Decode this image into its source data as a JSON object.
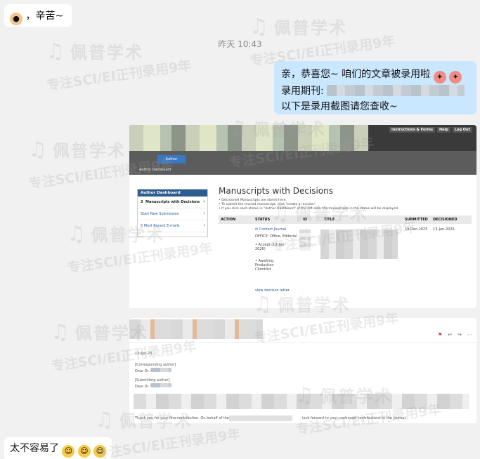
{
  "messages": {
    "first": {
      "text": "，辛苦~"
    },
    "timestamp": "昨天 10:43",
    "reply": {
      "line1": "亲，恭喜您~ 咱们的文章被录用啦",
      "line2_label": "录用期刊:",
      "line3": "以下是录用截图请您查收~"
    },
    "last": {
      "text": "太不容易了"
    }
  },
  "watermark": {
    "brand": "佩普学术",
    "slogan": "专注SCI/EI正刊录用9年"
  },
  "screenshot1": {
    "top_links": [
      "Instructions & Forms",
      "Help",
      "Log Out"
    ],
    "nav_tab": "Author",
    "dashboard_label": "Author Dashboard",
    "sidebar_title": "Author Dashboard",
    "sidebar_items": [
      {
        "count": "3",
        "label": "Manuscripts with Decisions"
      },
      {
        "label": "Start New Submission"
      },
      {
        "label": "5 Most Recent E-mails"
      }
    ],
    "main_title": "Manuscripts with Decisions",
    "bullets": [
      "Decisioned Manuscripts are stored here.",
      "To submit the revised manuscript, click \"create a revision\".",
      "If you click each status in \"Author Dashboard\" of the left side, the manuscripts in the status will be displayed."
    ],
    "columns": [
      "ACTION",
      "STATUS",
      "ID",
      "TITLE",
      "SUBMITTED",
      "DECISIONED"
    ],
    "row": {
      "contact": "Contact Journal",
      "office": "OFFICE: Office, Editorial",
      "accept": "Accept (13-Jan-2026)",
      "awaiting": "Awaiting Production Checklist",
      "submitted": "19-Dec-2025",
      "decisioned": "13-Jan-2026",
      "decision_link": "view decision letter"
    }
  },
  "screenshot2": {
    "date_fragment": "13-Jan-20",
    "corresponding": "[Corresponding author]",
    "dear1": "Dear Dr.",
    "submitting": "[Submitting author]",
    "dear2": "Dear Dr.",
    "footer_left": "Thank you for your fine contribution.  On behalf of the",
    "footer_right": "look forward to your continued contributions to the Journal."
  }
}
